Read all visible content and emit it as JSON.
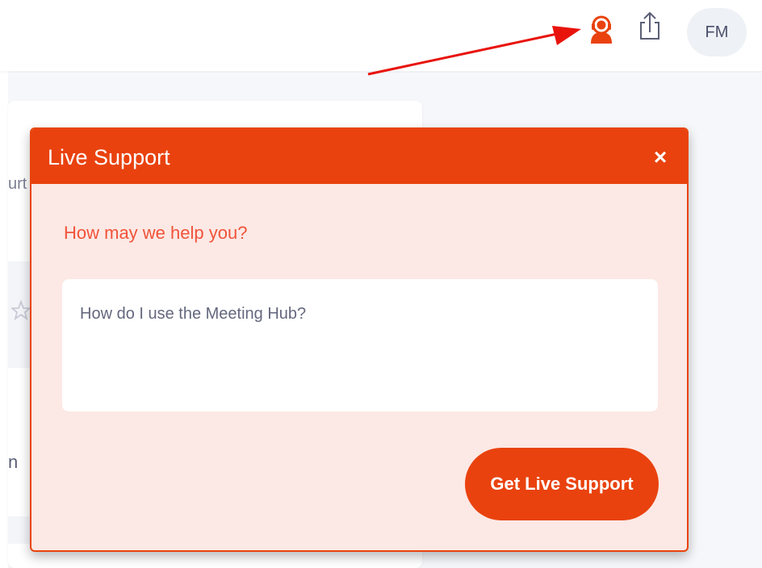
{
  "header": {
    "avatar_initials": "FM",
    "live_support_icon": "headset-icon",
    "share_icon": "share-icon",
    "accent_color": "#e9420e"
  },
  "background": {
    "partial_text_1": "urt",
    "partial_text_2": "n"
  },
  "popup": {
    "title": "Live Support",
    "close_label": "×",
    "prompt": "How may we help you?",
    "question_value": "How do I use the Meeting Hub?",
    "submit_label": "Get Live Support"
  }
}
